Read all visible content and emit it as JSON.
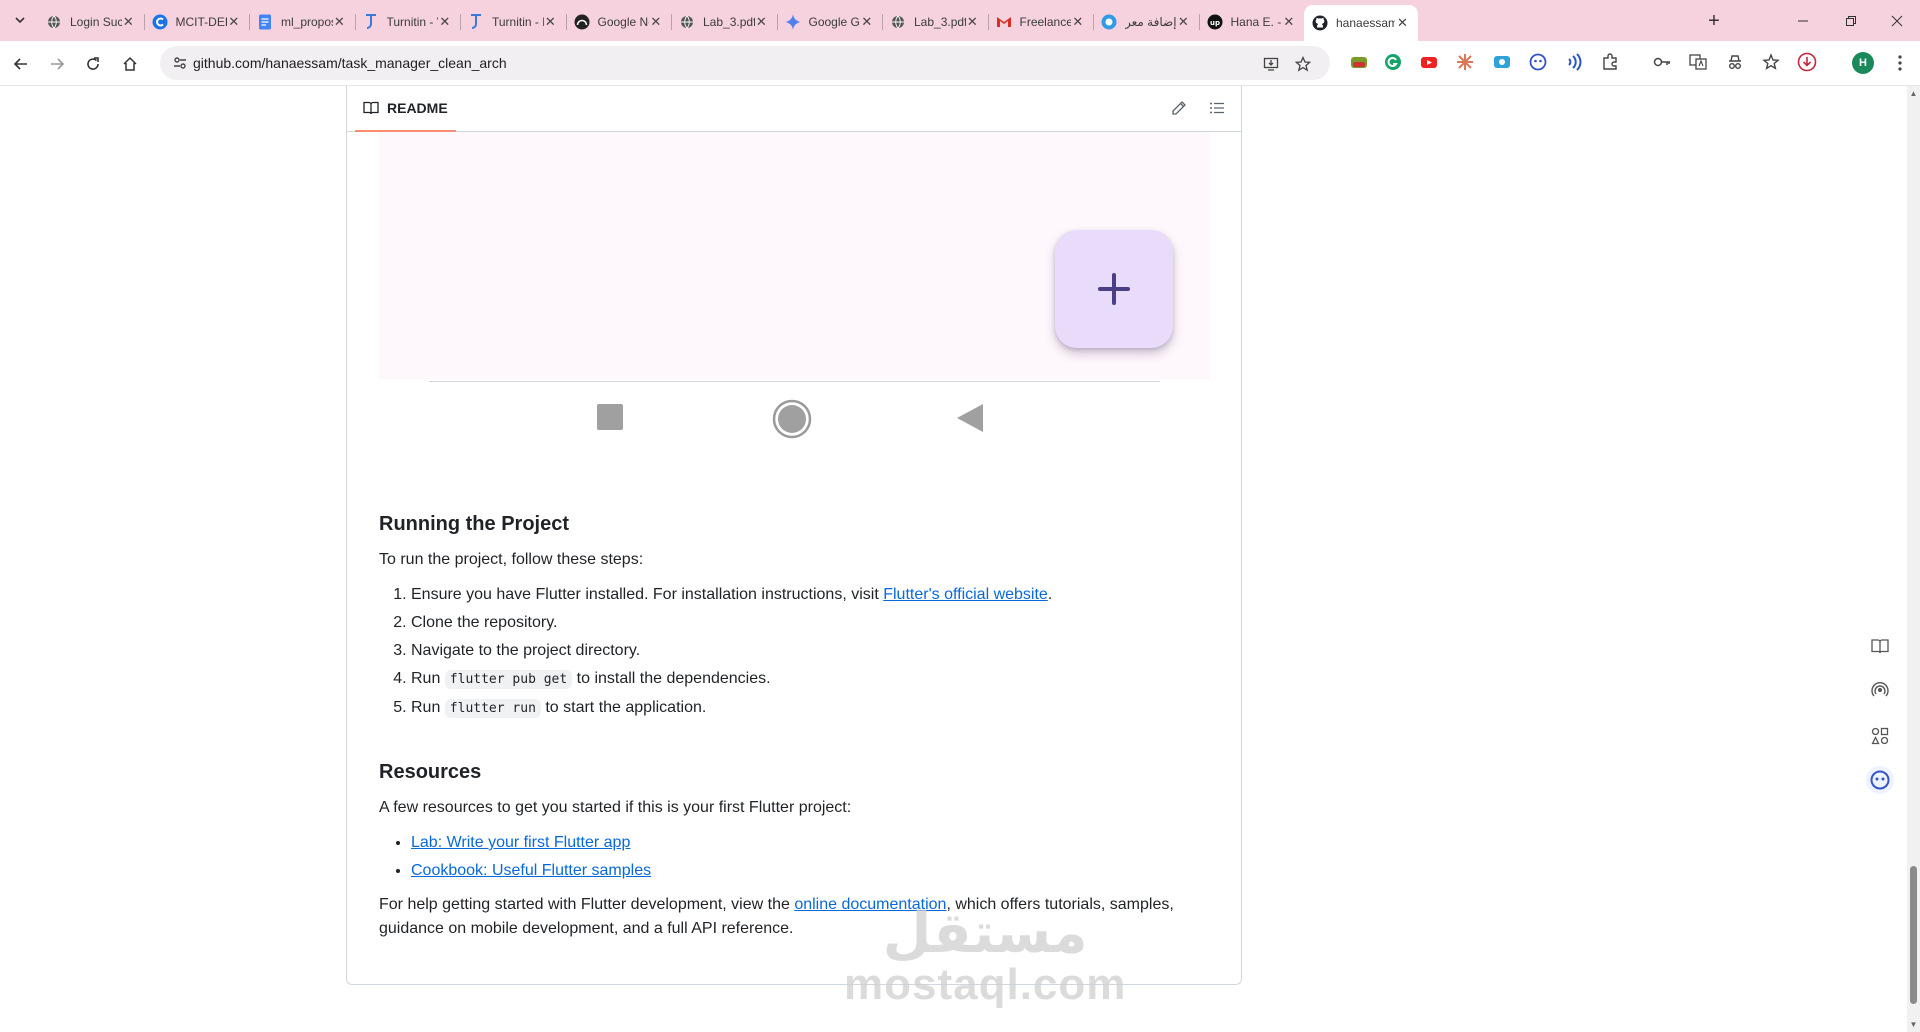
{
  "browser": {
    "tabs": [
      {
        "title": "Login Succ",
        "icon": "globe-icon"
      },
      {
        "title": "MCIT-DEBI",
        "icon": "c-logo-icon"
      },
      {
        "title": "ml_propos",
        "icon": "docs-icon"
      },
      {
        "title": "Turnitin - V",
        "icon": "turnitin-icon"
      },
      {
        "title": "Turnitin - N",
        "icon": "turnitin-icon"
      },
      {
        "title": "Google No",
        "icon": "notebooklm-icon"
      },
      {
        "title": "Lab_3.pdf",
        "icon": "globe-icon"
      },
      {
        "title": "Google Ge",
        "icon": "gemini-icon"
      },
      {
        "title": "Lab_3.pdf",
        "icon": "globe-icon"
      },
      {
        "title": "Freelance",
        "icon": "gmail-icon"
      },
      {
        "title": "إضافة معر",
        "icon": "blue-circle-icon"
      },
      {
        "title": "Hana E. - F",
        "icon": "upwork-icon"
      },
      {
        "title": "hanaessam",
        "icon": "github-icon"
      }
    ],
    "active_tab_index": 12,
    "url": "github.com/hanaessam/task_manager_clean_arch",
    "profile_initial": "H"
  },
  "readme": {
    "tab_label": "README",
    "running": {
      "heading": "Running the Project",
      "intro": "To run the project, follow these steps:",
      "step1_text": "Ensure you have Flutter installed. For installation instructions, visit ",
      "step1_link": "Flutter's official website",
      "step1_end": ".",
      "step2": "Clone the repository.",
      "step3": "Navigate to the project directory.",
      "step4_pre": "Run ",
      "step4_code": "flutter pub get",
      "step4_post": " to install the dependencies.",
      "step5_pre": "Run ",
      "step5_code": "flutter run",
      "step5_post": " to start the application."
    },
    "resources": {
      "heading": "Resources",
      "intro": "A few resources to get you started if this is your first Flutter project:",
      "link1": "Lab: Write your first Flutter app",
      "link2": "Cookbook: Useful Flutter samples",
      "help_pre": "For help getting started with Flutter development, view the ",
      "help_link": "online documentation",
      "help_post": ", which offers tutorials, samples, guidance on mobile development, and a full API reference."
    }
  },
  "watermark": {
    "arabic": "مستقل",
    "latin": "mostaql.com"
  },
  "colors": {
    "tabstrip": "#f6d2de",
    "link": "#0969da",
    "fab": "#e8dcfa",
    "fab_plus": "#4a3f86",
    "phone_bg": "#fef7fb"
  }
}
